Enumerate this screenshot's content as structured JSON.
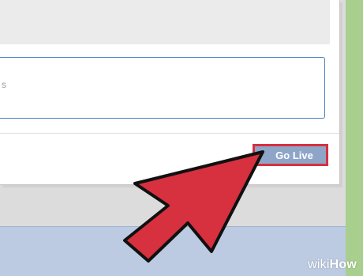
{
  "dialog": {
    "top_panel_text": "",
    "description_placeholder": "s",
    "go_live_label": "Go Live"
  },
  "overlay": {
    "arrow_icon": "pointer-arrow-icon",
    "arrow_color": "#d7303f"
  },
  "watermark": {
    "part1": "wiki",
    "part2": "How"
  },
  "colors": {
    "background": "#a9cf8f",
    "button_bg": "#8fa5c8",
    "focus_border": "#4a7fc1"
  }
}
